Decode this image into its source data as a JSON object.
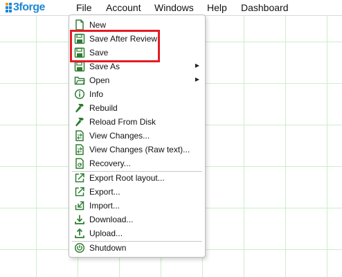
{
  "app": {
    "logo_text": "3forge",
    "logo_colors": [
      "#f39c12",
      "#1e88d6",
      "#1e88d6",
      "#1e88d6",
      "#1e88d6",
      "#1e88d6"
    ]
  },
  "menubar": {
    "items": [
      {
        "label": "File"
      },
      {
        "label": "Account"
      },
      {
        "label": "Windows"
      },
      {
        "label": "Help"
      },
      {
        "label": "Dashboard"
      }
    ]
  },
  "file_menu": {
    "items": [
      {
        "label": "New",
        "icon": "new-file-icon"
      },
      {
        "label": "Save After Review",
        "icon": "save-icon"
      },
      {
        "label": "Save",
        "icon": "save-icon"
      },
      {
        "label": "Save As",
        "icon": "save-icon",
        "submenu": true
      },
      {
        "label": "Open",
        "icon": "folder-icon",
        "submenu": true
      },
      {
        "label": "Info",
        "icon": "info-icon"
      },
      {
        "label": "Rebuild",
        "icon": "hammer-icon"
      },
      {
        "label": "Reload From Disk",
        "icon": "hammer-icon"
      },
      {
        "label": "View Changes...",
        "icon": "compare-icon"
      },
      {
        "label": "View Changes (Raw text)...",
        "icon": "compare-icon"
      },
      {
        "label": "Recovery...",
        "icon": "recovery-icon"
      },
      {
        "label": "Export Root layout...",
        "icon": "export-icon"
      },
      {
        "label": "Export...",
        "icon": "export-icon"
      },
      {
        "label": "Import...",
        "icon": "import-icon"
      },
      {
        "label": "Download...",
        "icon": "download-icon"
      },
      {
        "label": "Upload...",
        "icon": "upload-icon"
      },
      {
        "label": "Shutdown",
        "icon": "power-icon"
      }
    ],
    "submenu_arrow": "▶"
  },
  "colors": {
    "icon_green": "#2e7d32",
    "highlight_red": "#e31b23",
    "grid_line": "#c9efc9"
  }
}
